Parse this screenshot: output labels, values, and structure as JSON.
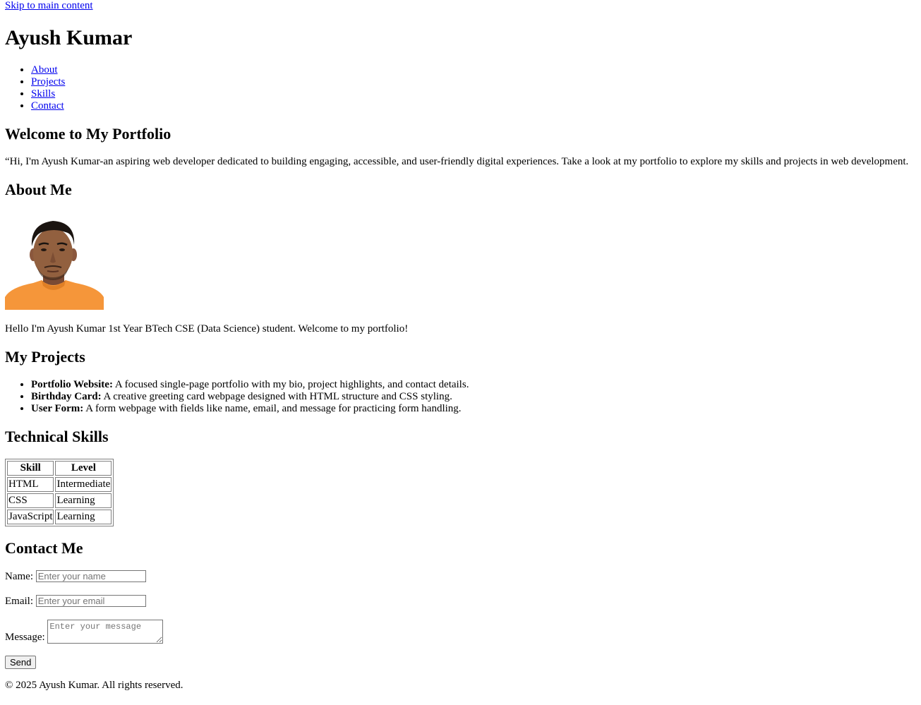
{
  "skip_link": "Skip to main content",
  "header": {
    "title": "Ayush Kumar",
    "nav": [
      "About",
      "Projects",
      "Skills",
      "Contact"
    ]
  },
  "welcome": {
    "heading": "Welcome to My Portfolio",
    "text": "“Hi, I'm Ayush Kumar-an aspiring web developer dedicated to building engaging, accessible, and user-friendly digital experiences. Take a look at my portfolio to explore my skills and projects in web development."
  },
  "about": {
    "heading": "About Me",
    "bio": "Hello I'm Ayush Kumar 1st Year BTech CSE (Data Science) student. Welcome to my portfolio!"
  },
  "projects": {
    "heading": "My Projects",
    "items": [
      {
        "name": "Portfolio Website:",
        "desc": " A focused single-page portfolio with my bio, project highlights, and contact details."
      },
      {
        "name": "Birthday Card:",
        "desc": " A creative greeting card webpage designed with HTML structure and CSS styling."
      },
      {
        "name": "User Form:",
        "desc": " A form webpage with fields like name, email, and message for practicing form handling."
      }
    ]
  },
  "skills": {
    "heading": "Technical Skills",
    "columns": [
      "Skill",
      "Level"
    ],
    "rows": [
      [
        "HTML",
        "Intermediate"
      ],
      [
        "CSS",
        "Learning"
      ],
      [
        "JavaScript",
        "Learning"
      ]
    ]
  },
  "contact": {
    "heading": "Contact Me",
    "name_label": "Name:",
    "name_placeholder": "Enter your name",
    "email_label": "Email:",
    "email_placeholder": "Enter your email",
    "message_label": "Message:",
    "message_placeholder": "Enter your message",
    "send_label": "Send"
  },
  "footer": {
    "text": "© 2025 Ayush Kumar. All rights reserved."
  },
  "colors": {
    "link": "#0000ee",
    "shirt": "#f5963a"
  }
}
